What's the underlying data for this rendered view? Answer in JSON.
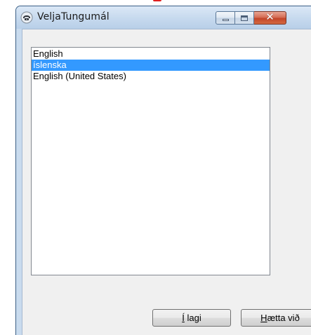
{
  "window": {
    "title": "VeljaTungumál",
    "icon": "telephone-app-icon",
    "caption_buttons": {
      "minimize_icon": "minimize-icon",
      "maximize_icon": "maximize-icon",
      "close_glyph": "✕"
    }
  },
  "languages": {
    "items": [
      {
        "label": "English",
        "selected": false
      },
      {
        "label": "íslenska",
        "selected": true
      },
      {
        "label": "English (United States)",
        "selected": false
      }
    ]
  },
  "buttons": {
    "ok": {
      "mnemonic": "Í",
      "rest": " lagi"
    },
    "cancel": {
      "mnemonic": "H",
      "rest": "ætta við"
    }
  },
  "colors": {
    "selection": "#3399ff",
    "close_button": "#c2452a"
  }
}
